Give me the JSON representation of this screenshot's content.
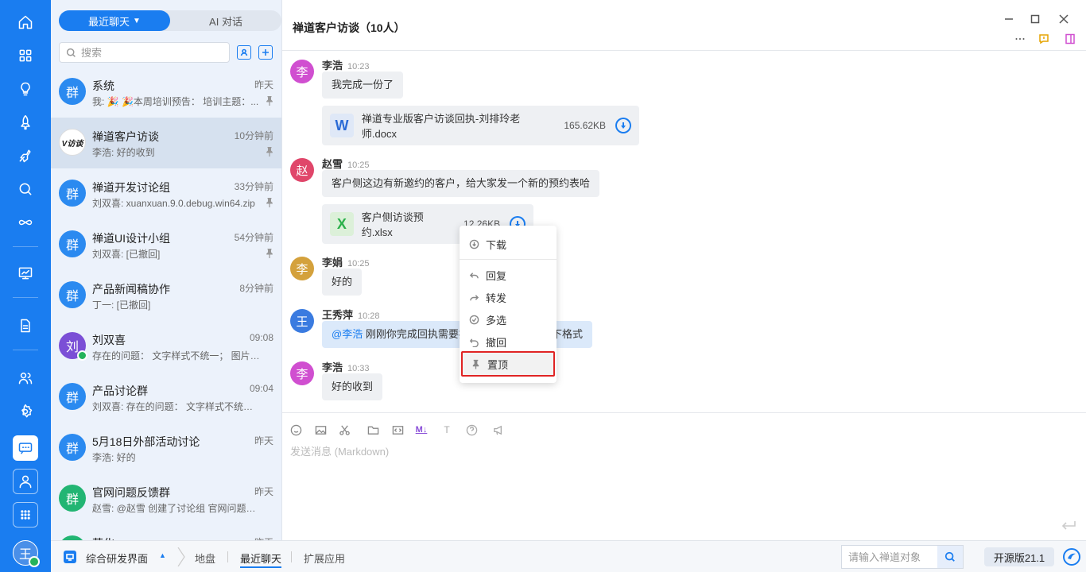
{
  "list_panel": {
    "tabs": [
      {
        "label": "最近聊天"
      },
      {
        "label": "AI 对话"
      }
    ],
    "search_placeholder": "搜索",
    "chats": [
      {
        "name": "系统",
        "time": "昨天",
        "preview": "我: 🎉 🎉本周培训预告： 培训主题：...",
        "avatar": "群",
        "color": "#2b8af0",
        "pinned": true
      },
      {
        "name": "禅道客户访谈",
        "time": "10分钟前",
        "preview": "李浩: 好的收到",
        "avatar": "V访谈",
        "color": "#ffffff",
        "pinned": true
      },
      {
        "name": "禅道开发讨论组",
        "time": "33分钟前",
        "preview": "刘双喜: xuanxuan.9.0.debug.win64.zip",
        "avatar": "群",
        "color": "#2b8af0",
        "pinned": true
      },
      {
        "name": "禅道UI设计小组",
        "time": "54分钟前",
        "preview": "刘双喜: [已撤回]",
        "avatar": "群",
        "color": "#2b8af0",
        "pinned": true
      },
      {
        "name": "产品新闻稿协作",
        "time": "8分钟前",
        "preview": "丁一: [已撤回]",
        "avatar": "群",
        "color": "#2b8af0",
        "pinned": false
      },
      {
        "name": "刘双喜",
        "time": "09:08",
        "preview": "存在的问题： 文字样式不统一； 图片大...",
        "avatar": "刘",
        "color": "#7b4fd6",
        "pinned": false
      },
      {
        "name": "产品讨论群",
        "time": "09:04",
        "preview": "刘双喜: 存在的问题： 文字样式不统一；...",
        "avatar": "群",
        "color": "#2b8af0",
        "pinned": false
      },
      {
        "name": "5月18日外部活动讨论",
        "time": "昨天",
        "preview": "李浩: 好的",
        "avatar": "群",
        "color": "#2b8af0",
        "pinned": false
      },
      {
        "name": "官网问题反馈群",
        "time": "昨天",
        "preview": "赵雪: @赵雪 创建了讨论组 官网问题反...",
        "avatar": "群",
        "color": "#22b573",
        "pinned": false
      },
      {
        "name": "营化",
        "time": "昨天",
        "preview": "",
        "avatar": "群",
        "color": "#22b573",
        "pinned": false
      }
    ]
  },
  "header": {
    "title": "禅道客户访谈（10人）"
  },
  "messages": [
    {
      "sender": "李浩",
      "time": "10:23",
      "avatar": "李",
      "color": "#d04fd0",
      "text": "我完成一份了"
    },
    {
      "file_name": "禅道专业版客户访谈回执-刘排玲老师.docx",
      "file_size": "165.62KB",
      "file_type": "W"
    },
    {
      "sender": "赵雪",
      "time": "10:25",
      "avatar": "赵",
      "color": "#e0466a",
      "text": "客户侧这边有新邀约的客户，给大家发一个新的预约表哈"
    },
    {
      "file_name": "客户侧访谈预约.xlsx",
      "file_size": "12.26KB",
      "file_type": "X"
    },
    {
      "sender": "李娟",
      "time": "10:25",
      "avatar": "李",
      "color": "#d4a13c",
      "text": "好的"
    },
    {
      "sender": "王秀萍",
      "time": "10:28",
      "avatar": "王",
      "color": "#3a7be0",
      "mention": "@李浩",
      "text": " 刚刚你完成回执需要按",
      "text_tail": "下格式"
    },
    {
      "sender": "李浩",
      "time": "10:33",
      "avatar": "李",
      "color": "#d04fd0",
      "text": "好的收到"
    }
  ],
  "context_menu": {
    "items": [
      {
        "label": "下载",
        "icon": "download-icon"
      },
      {
        "label": "回复",
        "icon": "reply-icon"
      },
      {
        "label": "转发",
        "icon": "forward-icon"
      },
      {
        "label": "多选",
        "icon": "multiselect-icon"
      },
      {
        "label": "撤回",
        "icon": "undo-icon"
      },
      {
        "label": "置顶",
        "icon": "pin-icon"
      }
    ]
  },
  "composer": {
    "placeholder": "发送消息 (Markdown)",
    "md_label": "M↓",
    "tt_label": "T"
  },
  "bottom_bar": {
    "workspace": "综合研发界面",
    "tabs": [
      "地盘",
      "最近聊天",
      "扩展应用"
    ],
    "active_tab": "最近聊天",
    "search_placeholder": "请输入禅道对象",
    "version": "开源版21.1"
  },
  "rail": {
    "avatar": "王"
  },
  "colors": {
    "accent": "#1a7df0",
    "highlight_border": "#e02424"
  }
}
